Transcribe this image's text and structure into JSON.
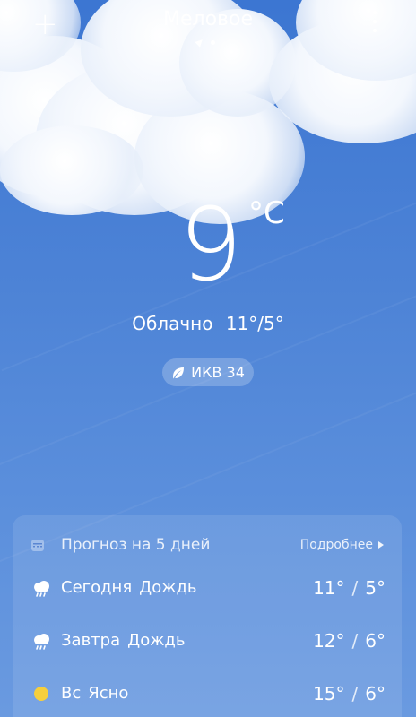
{
  "header": {
    "add_label": "+",
    "city": "Меловое"
  },
  "current": {
    "temperature": "9",
    "unit": "°C",
    "condition": "Облачно",
    "high_low": "11°/5°",
    "aqi_label": "ИКВ 34"
  },
  "forecast": {
    "title": "Прогноз на 5 дней",
    "more_label": "Подробнее",
    "days": [
      {
        "day": "Сегодня",
        "condition": "Дождь",
        "icon": "rain-cloud-icon",
        "high": "11°",
        "low": "5°"
      },
      {
        "day": "Завтра",
        "condition": "Дождь",
        "icon": "rain-cloud-icon",
        "high": "12°",
        "low": "6°"
      },
      {
        "day": "Вс",
        "condition": "Ясно",
        "icon": "sun-icon",
        "high": "15°",
        "low": "6°"
      }
    ]
  },
  "colors": {
    "sky_top": "#3c76d2",
    "sky_bottom": "#6a9ae0",
    "sun": "#f6cf3c"
  }
}
